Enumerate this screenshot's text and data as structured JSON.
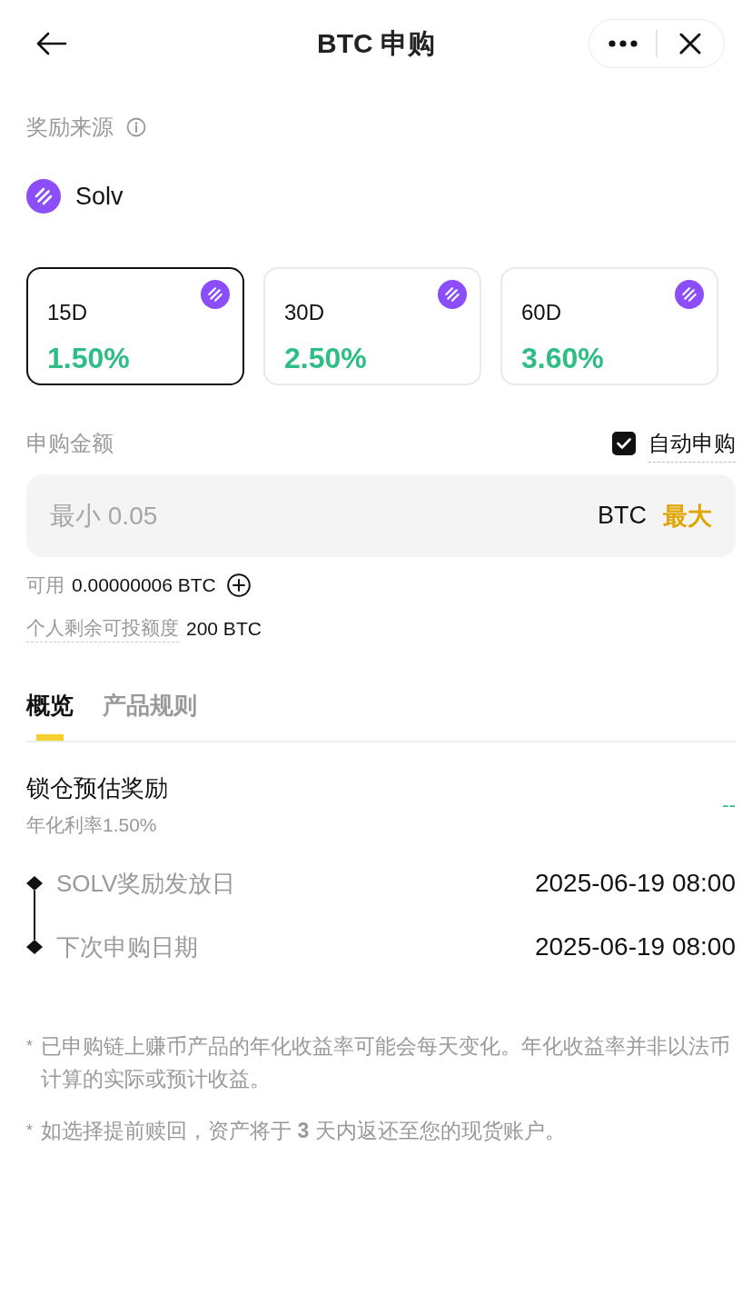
{
  "header": {
    "title": "BTC 申购"
  },
  "reward_source": {
    "label": "奖励来源",
    "provider": "Solv"
  },
  "terms": [
    {
      "duration": "15D",
      "rate": "1.50%",
      "selected": true
    },
    {
      "duration": "30D",
      "rate": "2.50%",
      "selected": false
    },
    {
      "duration": "60D",
      "rate": "3.60%",
      "selected": false
    }
  ],
  "amount": {
    "label": "申购金额",
    "auto_subscribe": {
      "label": "自动申购",
      "checked": true
    },
    "placeholder": "最小 0.05",
    "currency": "BTC",
    "max_button": "最大"
  },
  "available": {
    "label": "可用",
    "value": "0.00000006 BTC"
  },
  "quota": {
    "label": "个人剩余可投额度",
    "value": "200 BTC"
  },
  "tabs": [
    {
      "label": "概览",
      "selected": true
    },
    {
      "label": "产品规则",
      "selected": false
    }
  ],
  "overview": {
    "title": "锁仓预估奖励",
    "subtitle": "年化利率1.50%",
    "estimate": "--",
    "timeline": [
      {
        "label": "SOLV奖励发放日",
        "date": "2025-06-19 08:00"
      },
      {
        "label": "下次申购日期",
        "date": "2025-06-19 08:00"
      }
    ]
  },
  "notes": [
    {
      "mark": "*",
      "text": "已申购链上赚币产品的年化收益率可能会每天变化。年化收益率并非以法币计算的实际或预计收益。"
    },
    {
      "mark": "*",
      "text": "如选择提前赎回，资产将于 **3** 天内返还至您的现货账户。"
    }
  ]
}
